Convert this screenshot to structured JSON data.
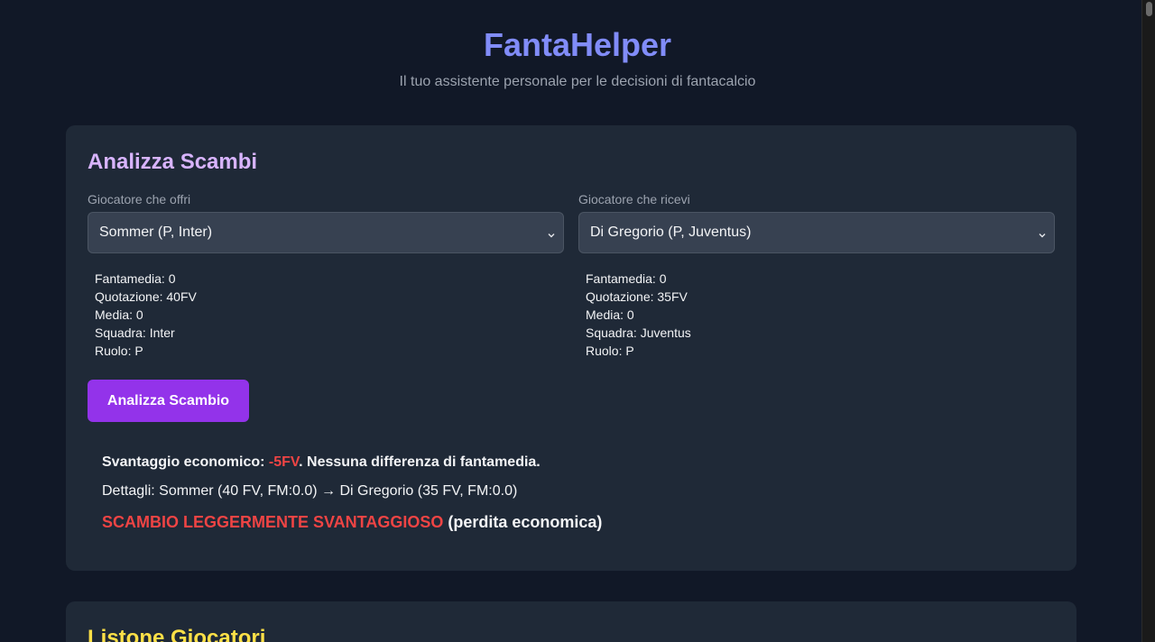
{
  "header": {
    "title": "FantaHelper",
    "subtitle": "Il tuo assistente personale per le decisioni di fantacalcio"
  },
  "trade": {
    "title": "Analizza Scambi",
    "offer": {
      "label": "Giocatore che offri",
      "selected": "Sommer (P, Inter)",
      "stats": [
        "Fantamedia: 0",
        "Quotazione: 40FV",
        "Media: 0",
        "Squadra: Inter",
        "Ruolo: P"
      ]
    },
    "receive": {
      "label": "Giocatore che ricevi",
      "selected": "Di Gregorio (P, Juventus)",
      "stats": [
        "Fantamedia: 0",
        "Quotazione: 35FV",
        "Media: 0",
        "Squadra: Juventus",
        "Ruolo: P"
      ]
    },
    "button_label": "Analizza Scambio",
    "result": {
      "line1_prefix": "Svantaggio economico: ",
      "line1_value": "-5FV",
      "line1_suffix": ". Nessuna differenza di fantamedia.",
      "line2_prefix": "Dettagli:",
      "line2_text": " Sommer (40 FV, FM:0.0) → Di Gregorio (35 FV, FM:0.0)",
      "verdict": "SCAMBIO LEGGERMENTE SVANTAGGIOSO",
      "verdict_note": " (perdita economica)"
    }
  },
  "list": {
    "title": "Listone Giocatori"
  },
  "icons": {
    "select_arrow": "chevron-down-icon"
  },
  "colors": {
    "title": "#818cf8",
    "trade_title": "#d8b4fe",
    "list_title": "#fde047",
    "button": "#9333ea",
    "negative": "#ef4444"
  }
}
